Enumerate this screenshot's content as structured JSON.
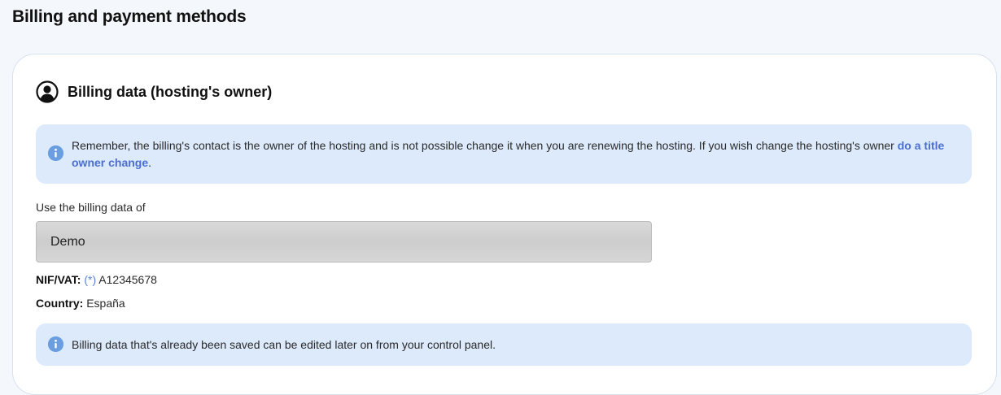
{
  "page": {
    "title": "Billing and payment methods"
  },
  "billing_section": {
    "title": "Billing data (hosting's owner)",
    "notice": {
      "text": "Remember, the billing's contact is the owner of the hosting and is not possible change it when you are renewing the hosting. If you wish change the hosting's owner ",
      "link_text": "do a title owner change",
      "suffix": "."
    },
    "select_label": "Use the billing data of",
    "select_value": "Demo",
    "nif": {
      "label": "NIF/VAT:",
      "required_mark": "(*)",
      "value": "A12345678"
    },
    "country": {
      "label": "Country:",
      "value": "España"
    },
    "footer_notice": "Billing data that's already been saved can be edited later on from your control panel."
  },
  "colors": {
    "alert_bg": "#dceafb",
    "info_icon": "#6a9ee0",
    "link": "#4b6fd0"
  },
  "icons": {
    "user": "user-circle-icon",
    "info": "info-icon"
  }
}
